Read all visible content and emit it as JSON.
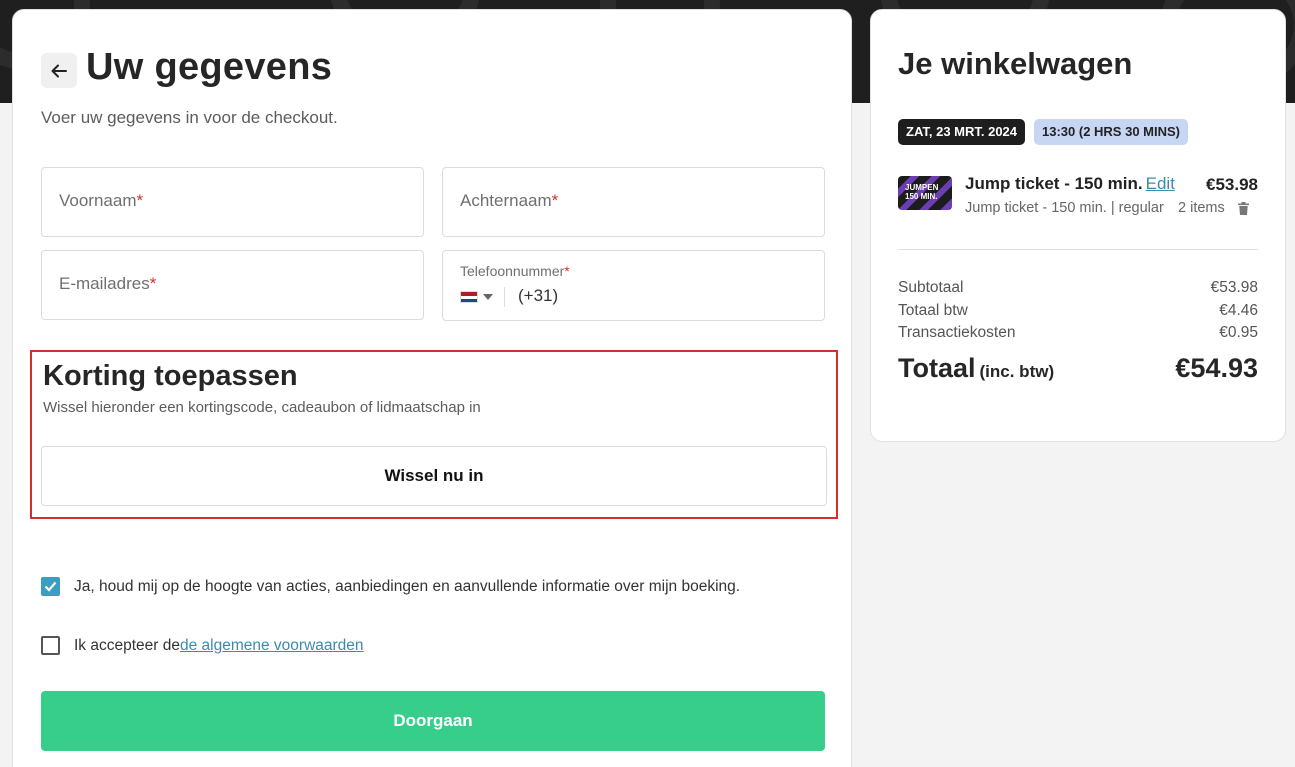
{
  "form": {
    "title": "Uw gegevens",
    "subtitle": "Voer uw gegevens in voor de checkout.",
    "required_mark": "*",
    "first_name": {
      "label": "Voornaam",
      "value": ""
    },
    "last_name": {
      "label": "Achternaam",
      "value": ""
    },
    "email": {
      "label": "E-mailadres",
      "value": ""
    },
    "phone": {
      "label": "Telefoonnummer",
      "dial_code": "(+31)",
      "value": ""
    }
  },
  "discount": {
    "title": "Korting toepassen",
    "subtitle": "Wissel hieronder een kortingscode, cadeaubon of lidmaatschap in",
    "button_label": "Wissel nu in"
  },
  "consent": {
    "newsletter_text": "Ja, houd mij op de hoogte van acties, aanbiedingen en aanvullende informatie over mijn boeking.",
    "newsletter_checked": true,
    "terms_prefix": "Ik accepteer de",
    "terms_link": "de algemene voorwaarden",
    "terms_checked": false
  },
  "continue_button": "Doorgaan",
  "cart": {
    "title": "Je winkelwagen",
    "date_badge": "ZAT, 23 MRT. 2024",
    "time_badge": "13:30 (2 HRS 30 MINS)",
    "item": {
      "thumb_text": "JUMPEN 150 MIN.",
      "name": "Jump ticket - 150 min.",
      "edit_label": "Edit",
      "price": "€53.98",
      "description": "Jump ticket - 150 min. | regular",
      "quantity": "2 items"
    },
    "summary": [
      {
        "label": "Subtotaal",
        "value": "€53.98"
      },
      {
        "label": "Totaal btw",
        "value": "€4.46"
      },
      {
        "label": "Transactiekosten",
        "value": "€0.95"
      }
    ],
    "total_label": "Totaal",
    "total_note": "(inc. btw)",
    "total_value": "€54.93"
  },
  "colors": {
    "accent_green": "#37cd8b",
    "link_blue": "#3a8bb0",
    "highlight_red": "#d32f2f",
    "checkbox_blue": "#3b9ec0"
  },
  "icons": {
    "back": "arrow-left-icon",
    "trash": "trash-icon",
    "check": "check-icon",
    "flag": "netherlands-flag-icon",
    "caret": "caret-down-icon"
  }
}
